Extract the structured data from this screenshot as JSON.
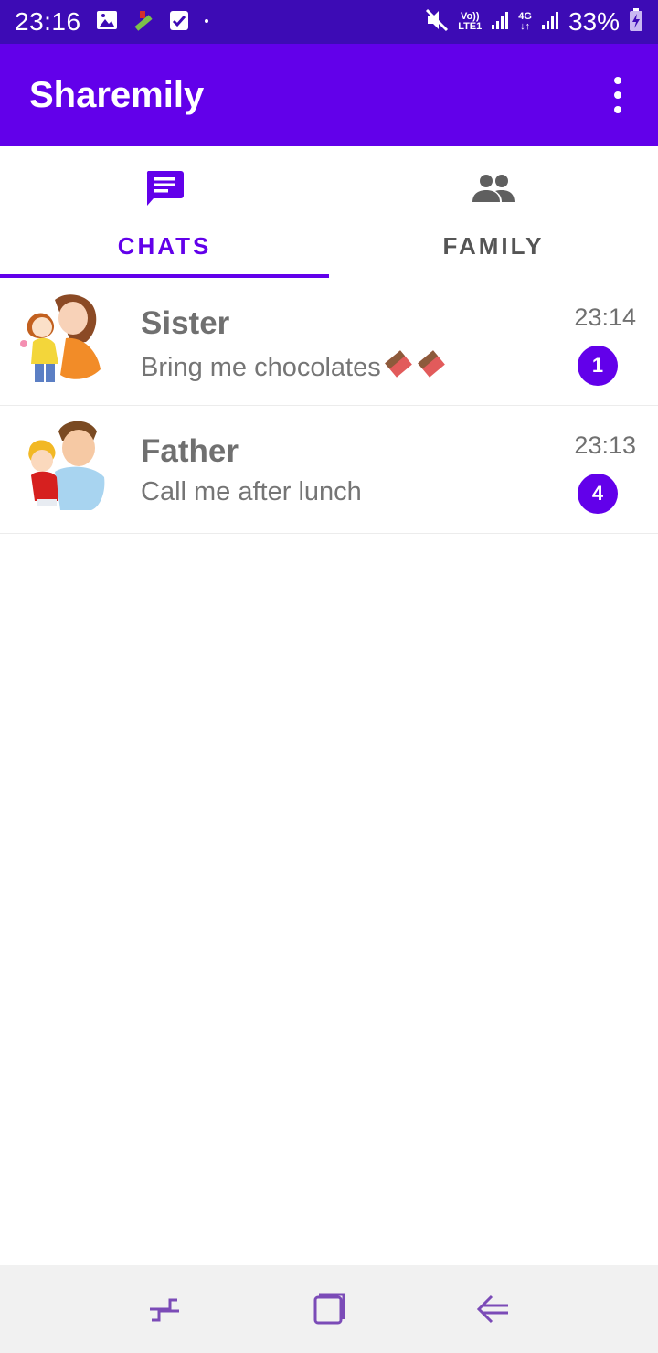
{
  "status_bar": {
    "time": "23:16",
    "volte_label": "Vo))",
    "lte_label": "LTE1",
    "network_label": "4G",
    "battery_percent": "33%"
  },
  "app_bar": {
    "title": "Sharemily",
    "menu_icon": "more-vert-icon"
  },
  "tabs": [
    {
      "label": "CHATS",
      "icon": "chat-icon",
      "active": true
    },
    {
      "label": "FAMILY",
      "icon": "people-icon",
      "active": false
    }
  ],
  "chats": [
    {
      "name": "Sister",
      "preview": "Bring me chocolates",
      "time": "23:14",
      "unread": "1",
      "avatar": "mother-daughter-avatar"
    },
    {
      "name": "Father",
      "preview": "Call me after lunch",
      "time": "23:13",
      "unread": "4",
      "avatar": "father-son-avatar"
    }
  ],
  "colors": {
    "primary": "#6200ea",
    "status_bar": "#3d0bb5",
    "text_gray": "#707070"
  }
}
